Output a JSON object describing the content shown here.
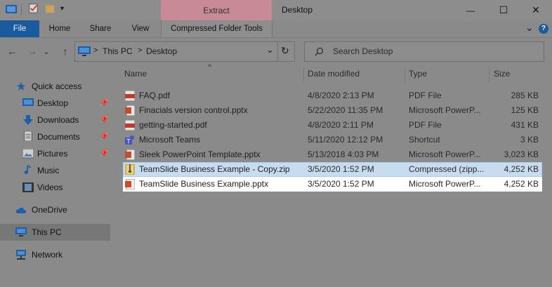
{
  "window": {
    "title": "Desktop",
    "extract_label": "Extract",
    "minimize_glyph": "—",
    "maximize_glyph": "☐",
    "close_glyph": "✕"
  },
  "ribbon": {
    "tabs": [
      "File",
      "Home",
      "Share",
      "View",
      "Compressed Folder Tools"
    ],
    "collapse_glyph": "⌄",
    "help_glyph": "?"
  },
  "address": {
    "root": "This PC",
    "sep1": ">",
    "current": "Desktop",
    "sep2": ">",
    "dropdown_glyph": "⌄",
    "refresh_glyph": "↻"
  },
  "search": {
    "placeholder": "Search Desktop"
  },
  "nav": {
    "back_glyph": "←",
    "forward_glyph": "→",
    "recent_glyph": "⌄",
    "up_glyph": "↑",
    "items": [
      {
        "label": "Quick access",
        "icon": "star-icon"
      },
      {
        "label": "Desktop",
        "icon": "desktop-folder-icon",
        "pinned": true
      },
      {
        "label": "Downloads",
        "icon": "downloads-icon",
        "pinned": true
      },
      {
        "label": "Documents",
        "icon": "documents-icon",
        "pinned": true
      },
      {
        "label": "Pictures",
        "icon": "pictures-icon",
        "pinned": true
      },
      {
        "label": "Music",
        "icon": "music-icon"
      },
      {
        "label": "Videos",
        "icon": "videos-icon"
      },
      {
        "label": "OneDrive",
        "icon": "onedrive-icon"
      },
      {
        "label": "This PC",
        "icon": "this-pc-icon"
      },
      {
        "label": "Network",
        "icon": "network-icon"
      }
    ]
  },
  "columns": {
    "name": "Name",
    "date": "Date modified",
    "type": "Type",
    "size": "Size",
    "sort_glyph": "^"
  },
  "files": [
    {
      "name": "FAQ.pdf",
      "date": "4/8/2020 2:13 PM",
      "type": "PDF File",
      "size": "285 KB",
      "icon": "pdf-icon"
    },
    {
      "name": "Finacials version control.pptx",
      "date": "5/22/2020 11:35 PM",
      "type": "Microsoft PowerP...",
      "size": "125 KB",
      "icon": "pptx-icon"
    },
    {
      "name": "getting-started.pdf",
      "date": "4/8/2020 2:11 PM",
      "type": "PDF File",
      "size": "431 KB",
      "icon": "pdf-icon"
    },
    {
      "name": "Microsoft Teams",
      "date": "5/11/2020 12:12 PM",
      "type": "Shortcut",
      "size": "3 KB",
      "icon": "teams-icon"
    },
    {
      "name": "Sleek PowerPoint Template.pptx",
      "date": "5/13/2018 4:03 PM",
      "type": "Microsoft PowerP...",
      "size": "3,023 KB",
      "icon": "pptx-icon"
    },
    {
      "name": "TeamSlide Business Example - Copy.zip",
      "date": "3/5/2020 1:52 PM",
      "type": "Compressed (zipp...",
      "size": "4,252 KB",
      "icon": "zip-icon"
    },
    {
      "name": "TeamSlide Business Example.pptx",
      "date": "3/5/2020 1:52 PM",
      "type": "Microsoft PowerP...",
      "size": "4,252 KB",
      "icon": "pptx-icon"
    }
  ],
  "colors": {
    "file_tab": "#1a5b9e",
    "extract_tab": "#c98a97",
    "selected_row": "#c7dcef"
  }
}
